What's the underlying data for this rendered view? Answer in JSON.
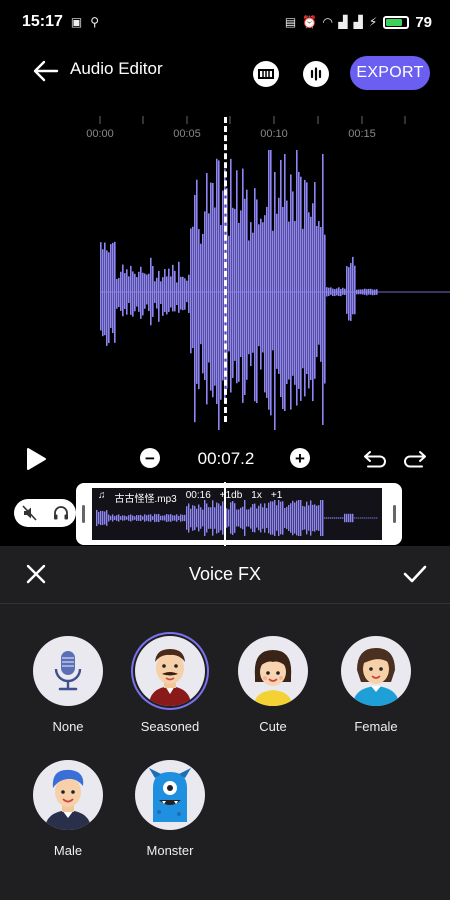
{
  "status_bar": {
    "time": "15:17",
    "battery": "79",
    "battery_level": 0.79
  },
  "appbar": {
    "title": "Audio Editor",
    "export_label": "EXPORT"
  },
  "ruler": {
    "labels": [
      "00:00",
      "00:05",
      "00:10",
      "00:15"
    ]
  },
  "controls": {
    "time": "00:07.2"
  },
  "track": {
    "filename": "古古怪怪.mp3",
    "duration": "00:16",
    "gain": "+1db",
    "speed": "1x",
    "pitch": "+1"
  },
  "panel": {
    "title": "Voice FX",
    "effects": [
      {
        "label": "None",
        "icon": "microphone-icon",
        "selected": false
      },
      {
        "label": "Seasoned",
        "icon": "seasoned-avatar-icon",
        "selected": true
      },
      {
        "label": "Cute",
        "icon": "cute-avatar-icon",
        "selected": false
      },
      {
        "label": "Female",
        "icon": "female-avatar-icon",
        "selected": false
      },
      {
        "label": "Male",
        "icon": "male-avatar-icon",
        "selected": false
      },
      {
        "label": "Monster",
        "icon": "monster-avatar-icon",
        "selected": false
      }
    ]
  },
  "colors": {
    "accent": "#6a5ff0",
    "waveform": "#8f86f5",
    "panel_bg": "#1f1f22"
  }
}
